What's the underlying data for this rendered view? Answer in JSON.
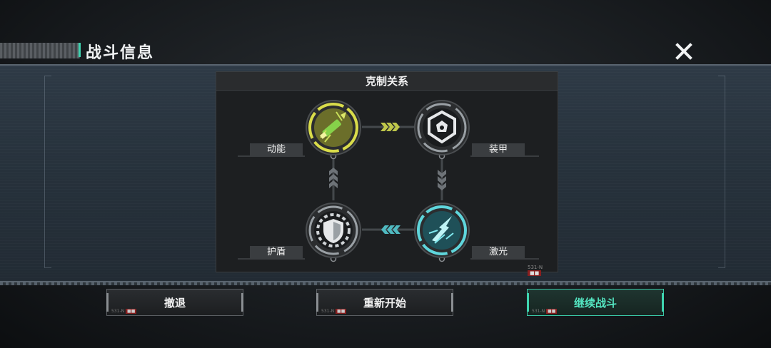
{
  "header": {
    "title": "战斗信息"
  },
  "chart": {
    "title": "克制关系",
    "nodes": {
      "kinetic": {
        "label": "动能",
        "icon": "missile-icon",
        "color": "#d9dc4a"
      },
      "armor": {
        "label": "装甲",
        "icon": "armor-core-icon",
        "color": "#cfd3d6"
      },
      "laser": {
        "label": "激光",
        "icon": "laser-burst-icon",
        "color": "#5fd6dc"
      },
      "shield": {
        "label": "护盾",
        "icon": "shield-icon",
        "color": "#cfd3d6"
      }
    },
    "footer_code": "531-N"
  },
  "buttons": {
    "retreat": {
      "label": "撤退",
      "code": "531-N"
    },
    "restart": {
      "label": "重新开始",
      "code": "531-N"
    },
    "continue": {
      "label": "继续战斗",
      "code": "531-N"
    }
  },
  "colors": {
    "accent": "#3fd4b0",
    "kinetic": "#d9dc4a",
    "laser": "#5fd6dc",
    "panel": "#26313b"
  }
}
